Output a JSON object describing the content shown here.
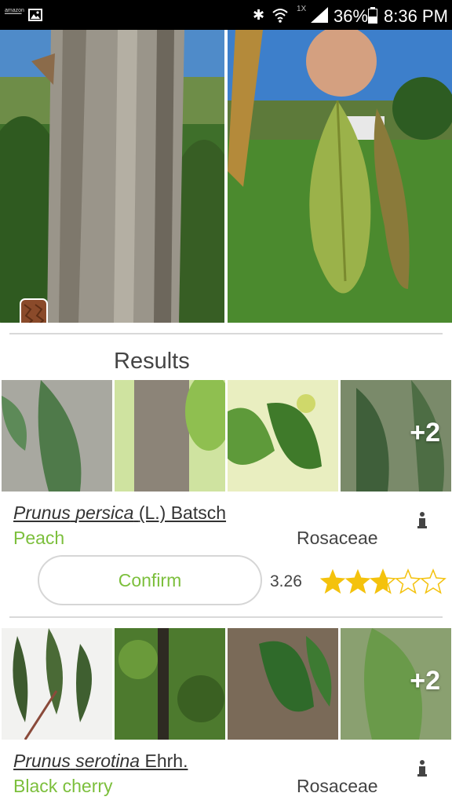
{
  "status_bar": {
    "left_label": "amazon",
    "signal_label": "1X",
    "battery": "36%",
    "time": "8:36 PM",
    "icons": [
      "image-notification-icon",
      "bluetooth-icon",
      "wifi-icon",
      "signal-icon",
      "battery-icon"
    ]
  },
  "results": {
    "title": "Results",
    "items": [
      {
        "genus": "Prunus",
        "epithet": "persica",
        "author": "(L.) Batsch",
        "common_name": "Peach",
        "family": "Rosaceae",
        "more_images": "+2",
        "confirm_label": "Confirm",
        "score": "3.26",
        "rating": 2.7
      },
      {
        "genus": "Prunus",
        "epithet": "serotina",
        "author": "Ehrh.",
        "common_name": "Black cherry",
        "family": "Rosaceae",
        "more_images": "+2"
      }
    ]
  },
  "colors": {
    "accent_green": "#7cbf3c",
    "star_gold": "#f4c20d"
  }
}
